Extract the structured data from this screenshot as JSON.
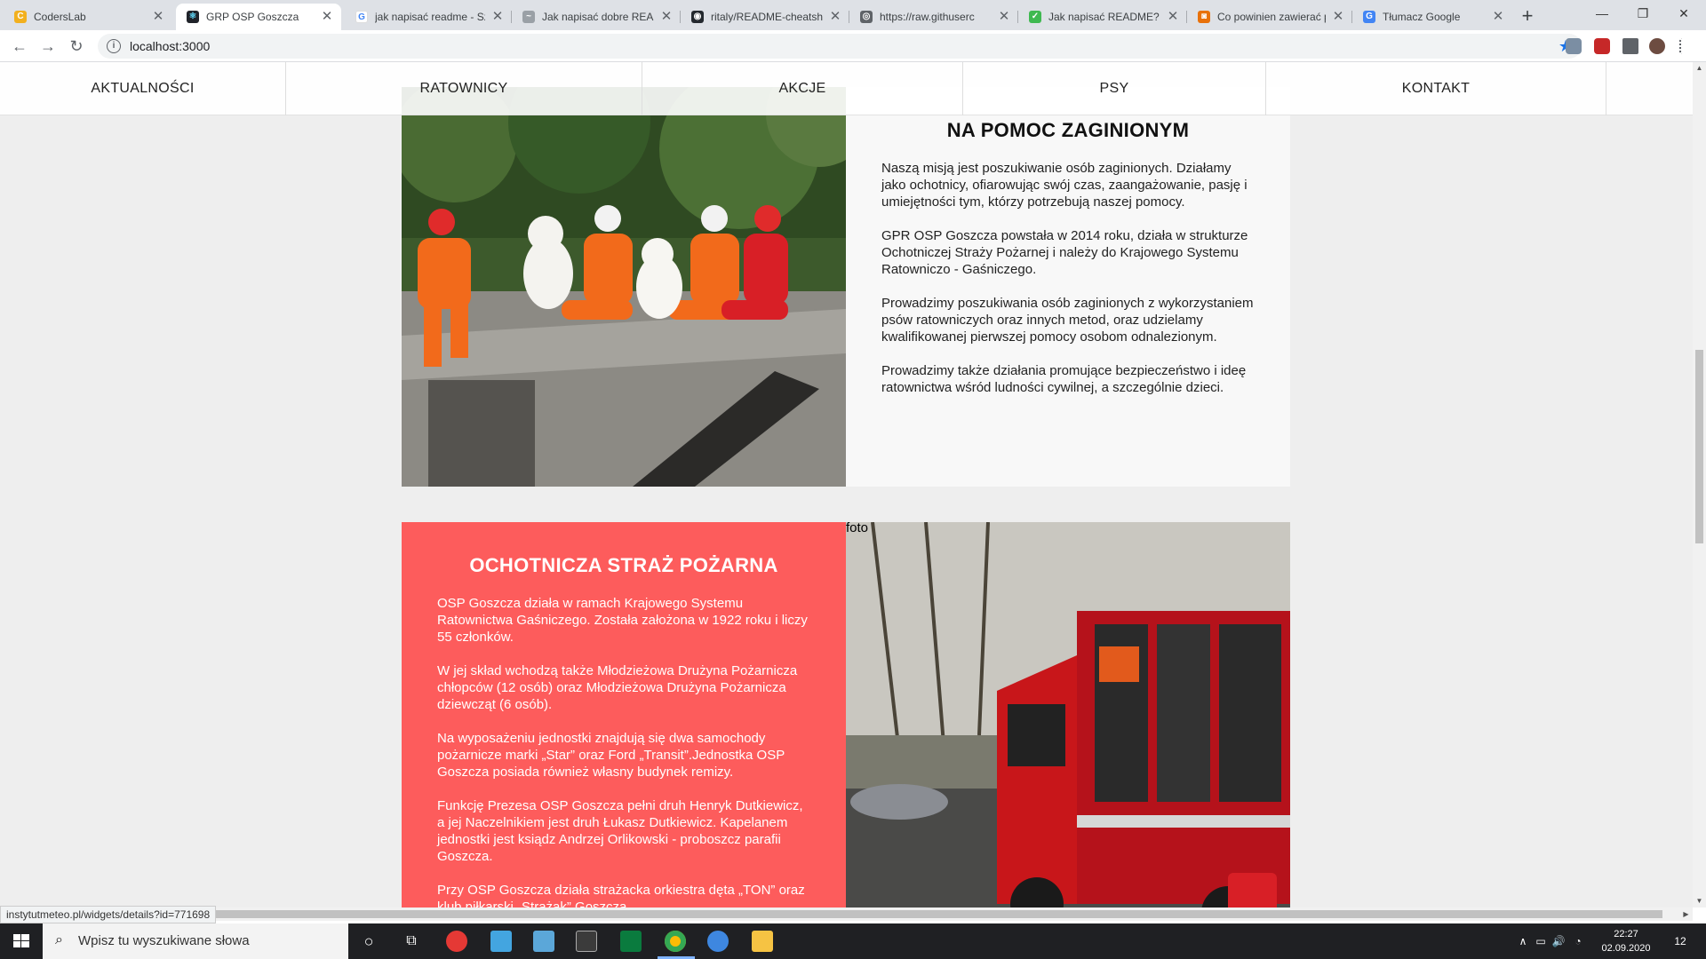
{
  "browser": {
    "tabs": [
      {
        "label": "CodersLab",
        "favicon_color": "#f2b01e",
        "favicon_char": "C"
      },
      {
        "label": "GRP OSP Goszcza",
        "favicon_color": "#61dafb",
        "favicon_char": "⚛"
      },
      {
        "label": "jak napisać readme - Sz",
        "favicon_color": "#4285f4",
        "favicon_char": "G"
      },
      {
        "label": "Jak napisać dobre READ",
        "favicon_color": "#9aa0a6",
        "favicon_char": "~"
      },
      {
        "label": "ritaly/README-cheatsh",
        "favicon_color": "#24292e",
        "favicon_char": "◉"
      },
      {
        "label": "https://raw.githuserc",
        "favicon_color": "#5f6368",
        "favicon_char": "◎"
      },
      {
        "label": "Jak napisać README? -",
        "favicon_color": "#3fb950",
        "favicon_char": "✓"
      },
      {
        "label": "Co powinien zawierać p",
        "favicon_color": "#e8710a",
        "favicon_char": "◙"
      },
      {
        "label": "Tłumacz Google",
        "favicon_color": "#4285f4",
        "favicon_char": "G"
      }
    ],
    "close_glyph": "✕",
    "new_tab_glyph": "+",
    "window_controls": {
      "minimize": "—",
      "restore": "❐",
      "close": "✕"
    },
    "nav": {
      "back": "←",
      "forward": "→",
      "reload": "↻"
    },
    "url": "localhost:3000",
    "info_glyph": "i",
    "bookmark_glyph": "★",
    "status_url": "instytutmeteo.pl/widgets/details?id=771698"
  },
  "site": {
    "nav": [
      {
        "label": "AKTUALNOŚCI"
      },
      {
        "label": "RATOWNICY"
      },
      {
        "label": "AKCJE"
      },
      {
        "label": "PSY"
      },
      {
        "label": "KONTAKT"
      }
    ],
    "mission": {
      "title": "NA POMOC ZAGINIONYM",
      "paragraphs": [
        "Naszą misją jest poszukiwanie osób zaginionych. Działamy jako ochotnicy, ofiarowując swój czas, zaangażowanie, pasję i umiejętności tym, którzy potrzebują naszej pomocy.",
        "GPR OSP Goszcza powstała w 2014 roku, działa w strukturze Ochotniczej Straży Pożarnej i należy do Krajowego Systemu Ratowniczo - Gaśniczego.",
        "Prowadzimy poszukiwania osób zaginionych z wykorzystaniem psów ratowniczych oraz innych metod, oraz udzielamy kwalifikowanej pierwszej pomocy osobom odnalezionym.",
        "Prowadzimy także działania promujące bezpieczeństwo i ideę ratownictwa wśród ludności cywilnej, a szczególnie dzieci."
      ]
    },
    "osp": {
      "title": "OCHOTNICZA STRAŻ POŻARNA",
      "image_alt": "foto",
      "paragraphs": [
        "OSP Goszcza działa w ramach Krajowego Systemu Ratownictwa Gaśniczego. Została założona w 1922 roku i liczy 55 członków.",
        "W jej skład wchodzą także Młodzieżowa Drużyna Pożarnicza chłopców (12 osób) oraz Młodzieżowa Drużyna Pożarnicza dziewcząt (6 osób).",
        "Na wyposażeniu jednostki znajdują się dwa samochody pożarnicze marki „Star” oraz Ford „Transit”.Jednostka OSP Goszcza posiada również własny budynek remizy.",
        "Funkcję Prezesa OSP Goszcza pełni druh Henryk Dutkiewicz, a jej Naczelnikiem jest druh Łukasz Dutkiewicz. Kapelanem jednostki jest ksiądz Andrzej Orlikowski - proboszcz parafii Goszcza.",
        "Przy OSP Goszcza działa strażacka orkiestra dęta „TON” oraz klub piłkarski „Strażak” Goszcza."
      ]
    }
  },
  "taskbar": {
    "search_placeholder": "Wpisz tu wyszukiwane słowa",
    "search_glyph": "⌕",
    "cortana_glyph": "○",
    "taskview_glyph": "⧉",
    "time": "22:27",
    "date": "02.09.2020",
    "notifications_count": "12",
    "tray": {
      "chevron": "∧",
      "battery": "▭",
      "volume": "🔊",
      "wifi": "◔"
    }
  },
  "colors": {
    "osp_panel": "#fd5c5c",
    "chrome_tabbar": "#dee1e6",
    "page_background": "#eeeeee",
    "taskbar": "#1f2023"
  }
}
